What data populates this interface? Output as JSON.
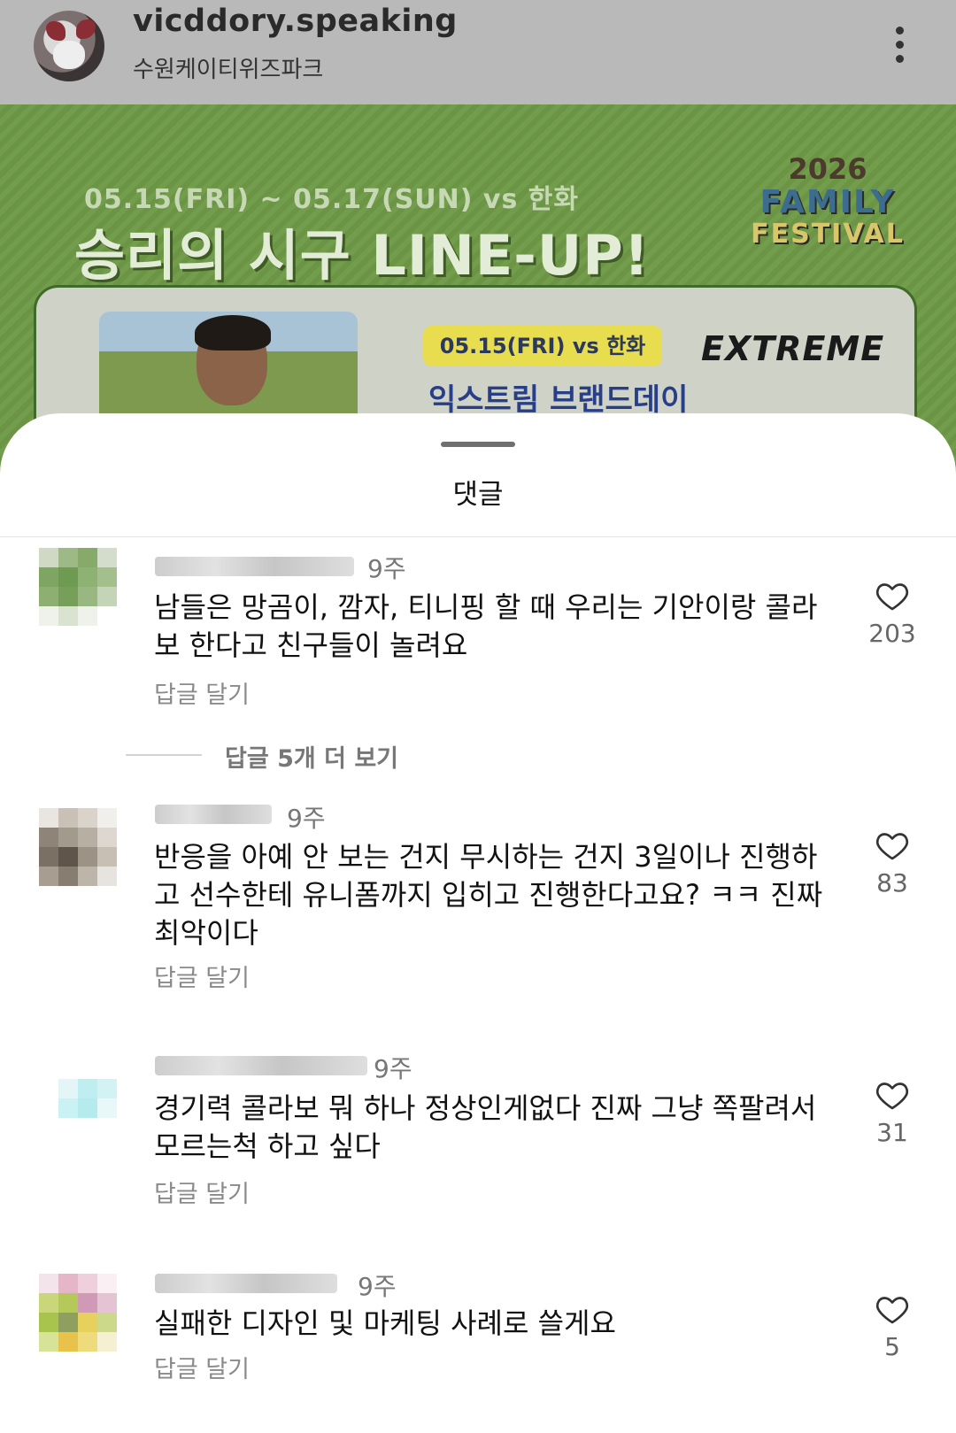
{
  "post": {
    "username": "vicddory.speaking",
    "location": "수원케이티위즈파크",
    "banner_date": "05.15(FRI) ~ 05.17(SUN) vs 한화",
    "banner_title": "승리의 시구 LINE-UP!",
    "logo_year": "2026",
    "logo_line1": "FAMILY",
    "logo_line2": "FESTIVAL",
    "card_date": "05.15(FRI) vs 한화",
    "card_brand_day": "익스트림 브랜드데이",
    "card_brand_logo": "EXTREME"
  },
  "sheet": {
    "title": "댓글"
  },
  "comments": [
    {
      "time": "9주",
      "text": "남들은 망곰이, 깜자, 티니핑 할 때 우리는 기안이랑 콜라보 한다고 친구들이 놀려요",
      "reply_label": "답글 달기",
      "likes": "203",
      "more_replies": "답글 5개 더 보기"
    },
    {
      "time": "9주",
      "text": "반응을 아예 안 보는 건지 무시하는 건지 3일이나 진행하고 선수한테 유니폼까지 입히고 진행한다고요? ㅋㅋ 진짜 최악이다",
      "reply_label": "답글 달기",
      "likes": "83"
    },
    {
      "time": "9주",
      "text": "경기력 콜라보 뭐 하나 정상인게없다 진짜 그냥 쪽팔려서 모르는척 하고 싶다",
      "reply_label": "답글 달기",
      "likes": "31"
    },
    {
      "time": "9주",
      "text": "실패한 디자인 및 마케팅 사례로 쓸게요",
      "reply_label": "답글 달기",
      "likes": "5"
    }
  ],
  "icons": {
    "like": "heart-icon",
    "more": "more-vertical-icon"
  },
  "colors": {
    "post_green": "#6e9a46",
    "dim_header": "#b9b9b9",
    "card_pill": "#e8dc4f",
    "brand_blue": "#283e86"
  }
}
